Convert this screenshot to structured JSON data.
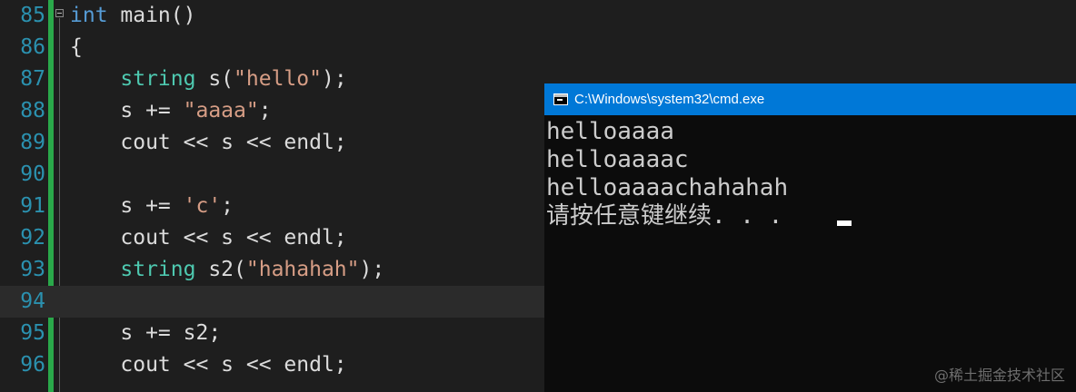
{
  "editor": {
    "lines": [
      {
        "num": "85",
        "parts": [
          {
            "t": "int",
            "c": "kw"
          },
          {
            "t": " main()",
            "c": "fn"
          }
        ]
      },
      {
        "num": "86",
        "parts": [
          {
            "t": "{",
            "c": "fn"
          }
        ]
      },
      {
        "num": "87",
        "parts": [
          {
            "t": "    ",
            "c": "fn"
          },
          {
            "t": "string",
            "c": "ty"
          },
          {
            "t": " s(",
            "c": "fn"
          },
          {
            "t": "\"hello\"",
            "c": "str"
          },
          {
            "t": ");",
            "c": "fn"
          }
        ]
      },
      {
        "num": "88",
        "parts": [
          {
            "t": "    s += ",
            "c": "fn"
          },
          {
            "t": "\"aaaa\"",
            "c": "str"
          },
          {
            "t": ";",
            "c": "fn"
          }
        ]
      },
      {
        "num": "89",
        "parts": [
          {
            "t": "    cout << s << endl;",
            "c": "fn"
          }
        ]
      },
      {
        "num": "90",
        "parts": []
      },
      {
        "num": "91",
        "parts": [
          {
            "t": "    s += ",
            "c": "fn"
          },
          {
            "t": "'c'",
            "c": "str"
          },
          {
            "t": ";",
            "c": "fn"
          }
        ]
      },
      {
        "num": "92",
        "parts": [
          {
            "t": "    cout << s << endl;",
            "c": "fn"
          }
        ]
      },
      {
        "num": "93",
        "parts": [
          {
            "t": "    ",
            "c": "fn"
          },
          {
            "t": "string",
            "c": "ty"
          },
          {
            "t": " s2(",
            "c": "fn"
          },
          {
            "t": "\"hahahah\"",
            "c": "str"
          },
          {
            "t": ");",
            "c": "fn"
          }
        ]
      },
      {
        "num": "94",
        "parts": [],
        "current": true
      },
      {
        "num": "95",
        "parts": [
          {
            "t": "    s += s2;",
            "c": "fn"
          }
        ]
      },
      {
        "num": "96",
        "parts": [
          {
            "t": "    cout << s << endl;",
            "c": "fn"
          }
        ]
      }
    ]
  },
  "console": {
    "title": "C:\\Windows\\system32\\cmd.exe",
    "lines": [
      "helloaaaa",
      "helloaaaac",
      "helloaaaachahahah"
    ],
    "prompt": "请按任意键继续. . ."
  },
  "watermark": "@稀土掘金技术社区",
  "colors": {
    "titlebar": "#0078d7",
    "gutter_accent": "#2aa84a",
    "keyword": "#569cd6",
    "type": "#4ec9b0",
    "string": "#d69d85",
    "line_number": "#2b91af"
  }
}
